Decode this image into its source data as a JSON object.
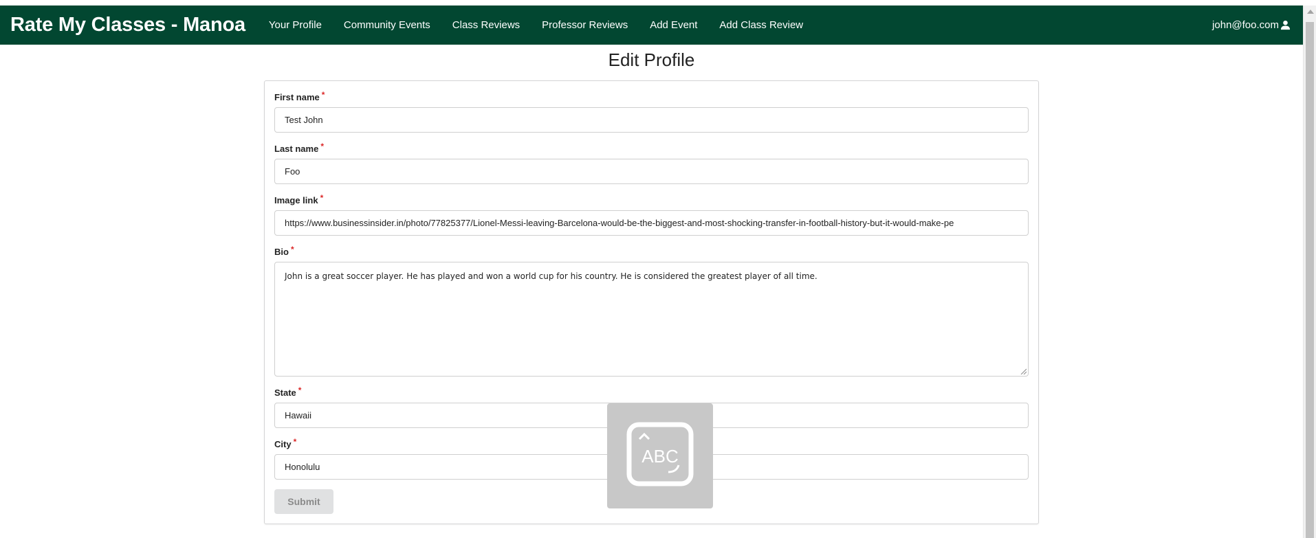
{
  "navbar": {
    "brand": "Rate My Classes - Manoa",
    "items": [
      {
        "label": "Your Profile"
      },
      {
        "label": "Community Events"
      },
      {
        "label": "Class Reviews"
      },
      {
        "label": "Professor Reviews"
      },
      {
        "label": "Add Event"
      },
      {
        "label": "Add Class Review"
      }
    ],
    "user_email": "john@foo.com",
    "user_icon": "user-icon"
  },
  "page": {
    "title": "Edit Profile"
  },
  "form": {
    "first_name": {
      "label": "First name",
      "value": "Test John",
      "required_mark": "*"
    },
    "last_name": {
      "label": "Last name",
      "value": "Foo",
      "required_mark": "*"
    },
    "image_link": {
      "label": "Image link",
      "value": "https://www.businessinsider.in/photo/77825377/Lionel-Messi-leaving-Barcelona-would-be-the-biggest-and-most-shocking-transfer-in-football-history-but-it-would-make-pe",
      "required_mark": "*"
    },
    "bio": {
      "label": "Bio",
      "value": "John is a great soccer player. He has played and won a world cup for his country. He is considered the greatest player of all time.",
      "required_mark": "*"
    },
    "state": {
      "label": "State",
      "value": "Hawaii",
      "required_mark": "*"
    },
    "city": {
      "label": "City",
      "value": "Honolulu",
      "required_mark": "*"
    },
    "submit_label": "Submit"
  },
  "overlay": {
    "icon": "keyboard-abc-icon",
    "text": "ABC"
  },
  "colors": {
    "navbar_bg": "#024731",
    "required": "#db2828",
    "button_bg": "#e0e1e2"
  }
}
